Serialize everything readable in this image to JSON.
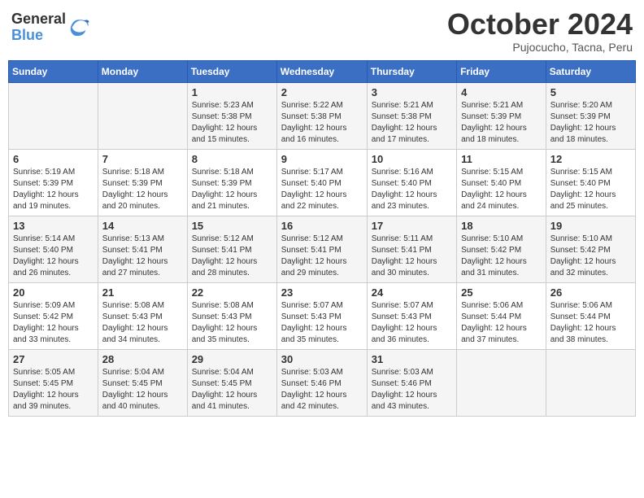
{
  "logo": {
    "general": "General",
    "blue": "Blue"
  },
  "title": "October 2024",
  "subtitle": "Pujocucho, Tacna, Peru",
  "headers": [
    "Sunday",
    "Monday",
    "Tuesday",
    "Wednesday",
    "Thursday",
    "Friday",
    "Saturday"
  ],
  "weeks": [
    [
      {
        "day": "",
        "sunrise": "",
        "sunset": "",
        "daylight": ""
      },
      {
        "day": "",
        "sunrise": "",
        "sunset": "",
        "daylight": ""
      },
      {
        "day": "1",
        "sunrise": "Sunrise: 5:23 AM",
        "sunset": "Sunset: 5:38 PM",
        "daylight": "Daylight: 12 hours and 15 minutes."
      },
      {
        "day": "2",
        "sunrise": "Sunrise: 5:22 AM",
        "sunset": "Sunset: 5:38 PM",
        "daylight": "Daylight: 12 hours and 16 minutes."
      },
      {
        "day": "3",
        "sunrise": "Sunrise: 5:21 AM",
        "sunset": "Sunset: 5:38 PM",
        "daylight": "Daylight: 12 hours and 17 minutes."
      },
      {
        "day": "4",
        "sunrise": "Sunrise: 5:21 AM",
        "sunset": "Sunset: 5:39 PM",
        "daylight": "Daylight: 12 hours and 18 minutes."
      },
      {
        "day": "5",
        "sunrise": "Sunrise: 5:20 AM",
        "sunset": "Sunset: 5:39 PM",
        "daylight": "Daylight: 12 hours and 18 minutes."
      }
    ],
    [
      {
        "day": "6",
        "sunrise": "Sunrise: 5:19 AM",
        "sunset": "Sunset: 5:39 PM",
        "daylight": "Daylight: 12 hours and 19 minutes."
      },
      {
        "day": "7",
        "sunrise": "Sunrise: 5:18 AM",
        "sunset": "Sunset: 5:39 PM",
        "daylight": "Daylight: 12 hours and 20 minutes."
      },
      {
        "day": "8",
        "sunrise": "Sunrise: 5:18 AM",
        "sunset": "Sunset: 5:39 PM",
        "daylight": "Daylight: 12 hours and 21 minutes."
      },
      {
        "day": "9",
        "sunrise": "Sunrise: 5:17 AM",
        "sunset": "Sunset: 5:40 PM",
        "daylight": "Daylight: 12 hours and 22 minutes."
      },
      {
        "day": "10",
        "sunrise": "Sunrise: 5:16 AM",
        "sunset": "Sunset: 5:40 PM",
        "daylight": "Daylight: 12 hours and 23 minutes."
      },
      {
        "day": "11",
        "sunrise": "Sunrise: 5:15 AM",
        "sunset": "Sunset: 5:40 PM",
        "daylight": "Daylight: 12 hours and 24 minutes."
      },
      {
        "day": "12",
        "sunrise": "Sunrise: 5:15 AM",
        "sunset": "Sunset: 5:40 PM",
        "daylight": "Daylight: 12 hours and 25 minutes."
      }
    ],
    [
      {
        "day": "13",
        "sunrise": "Sunrise: 5:14 AM",
        "sunset": "Sunset: 5:40 PM",
        "daylight": "Daylight: 12 hours and 26 minutes."
      },
      {
        "day": "14",
        "sunrise": "Sunrise: 5:13 AM",
        "sunset": "Sunset: 5:41 PM",
        "daylight": "Daylight: 12 hours and 27 minutes."
      },
      {
        "day": "15",
        "sunrise": "Sunrise: 5:12 AM",
        "sunset": "Sunset: 5:41 PM",
        "daylight": "Daylight: 12 hours and 28 minutes."
      },
      {
        "day": "16",
        "sunrise": "Sunrise: 5:12 AM",
        "sunset": "Sunset: 5:41 PM",
        "daylight": "Daylight: 12 hours and 29 minutes."
      },
      {
        "day": "17",
        "sunrise": "Sunrise: 5:11 AM",
        "sunset": "Sunset: 5:41 PM",
        "daylight": "Daylight: 12 hours and 30 minutes."
      },
      {
        "day": "18",
        "sunrise": "Sunrise: 5:10 AM",
        "sunset": "Sunset: 5:42 PM",
        "daylight": "Daylight: 12 hours and 31 minutes."
      },
      {
        "day": "19",
        "sunrise": "Sunrise: 5:10 AM",
        "sunset": "Sunset: 5:42 PM",
        "daylight": "Daylight: 12 hours and 32 minutes."
      }
    ],
    [
      {
        "day": "20",
        "sunrise": "Sunrise: 5:09 AM",
        "sunset": "Sunset: 5:42 PM",
        "daylight": "Daylight: 12 hours and 33 minutes."
      },
      {
        "day": "21",
        "sunrise": "Sunrise: 5:08 AM",
        "sunset": "Sunset: 5:43 PM",
        "daylight": "Daylight: 12 hours and 34 minutes."
      },
      {
        "day": "22",
        "sunrise": "Sunrise: 5:08 AM",
        "sunset": "Sunset: 5:43 PM",
        "daylight": "Daylight: 12 hours and 35 minutes."
      },
      {
        "day": "23",
        "sunrise": "Sunrise: 5:07 AM",
        "sunset": "Sunset: 5:43 PM",
        "daylight": "Daylight: 12 hours and 35 minutes."
      },
      {
        "day": "24",
        "sunrise": "Sunrise: 5:07 AM",
        "sunset": "Sunset: 5:43 PM",
        "daylight": "Daylight: 12 hours and 36 minutes."
      },
      {
        "day": "25",
        "sunrise": "Sunrise: 5:06 AM",
        "sunset": "Sunset: 5:44 PM",
        "daylight": "Daylight: 12 hours and 37 minutes."
      },
      {
        "day": "26",
        "sunrise": "Sunrise: 5:06 AM",
        "sunset": "Sunset: 5:44 PM",
        "daylight": "Daylight: 12 hours and 38 minutes."
      }
    ],
    [
      {
        "day": "27",
        "sunrise": "Sunrise: 5:05 AM",
        "sunset": "Sunset: 5:45 PM",
        "daylight": "Daylight: 12 hours and 39 minutes."
      },
      {
        "day": "28",
        "sunrise": "Sunrise: 5:04 AM",
        "sunset": "Sunset: 5:45 PM",
        "daylight": "Daylight: 12 hours and 40 minutes."
      },
      {
        "day": "29",
        "sunrise": "Sunrise: 5:04 AM",
        "sunset": "Sunset: 5:45 PM",
        "daylight": "Daylight: 12 hours and 41 minutes."
      },
      {
        "day": "30",
        "sunrise": "Sunrise: 5:03 AM",
        "sunset": "Sunset: 5:46 PM",
        "daylight": "Daylight: 12 hours and 42 minutes."
      },
      {
        "day": "31",
        "sunrise": "Sunrise: 5:03 AM",
        "sunset": "Sunset: 5:46 PM",
        "daylight": "Daylight: 12 hours and 43 minutes."
      },
      {
        "day": "",
        "sunrise": "",
        "sunset": "",
        "daylight": ""
      },
      {
        "day": "",
        "sunrise": "",
        "sunset": "",
        "daylight": ""
      }
    ]
  ]
}
